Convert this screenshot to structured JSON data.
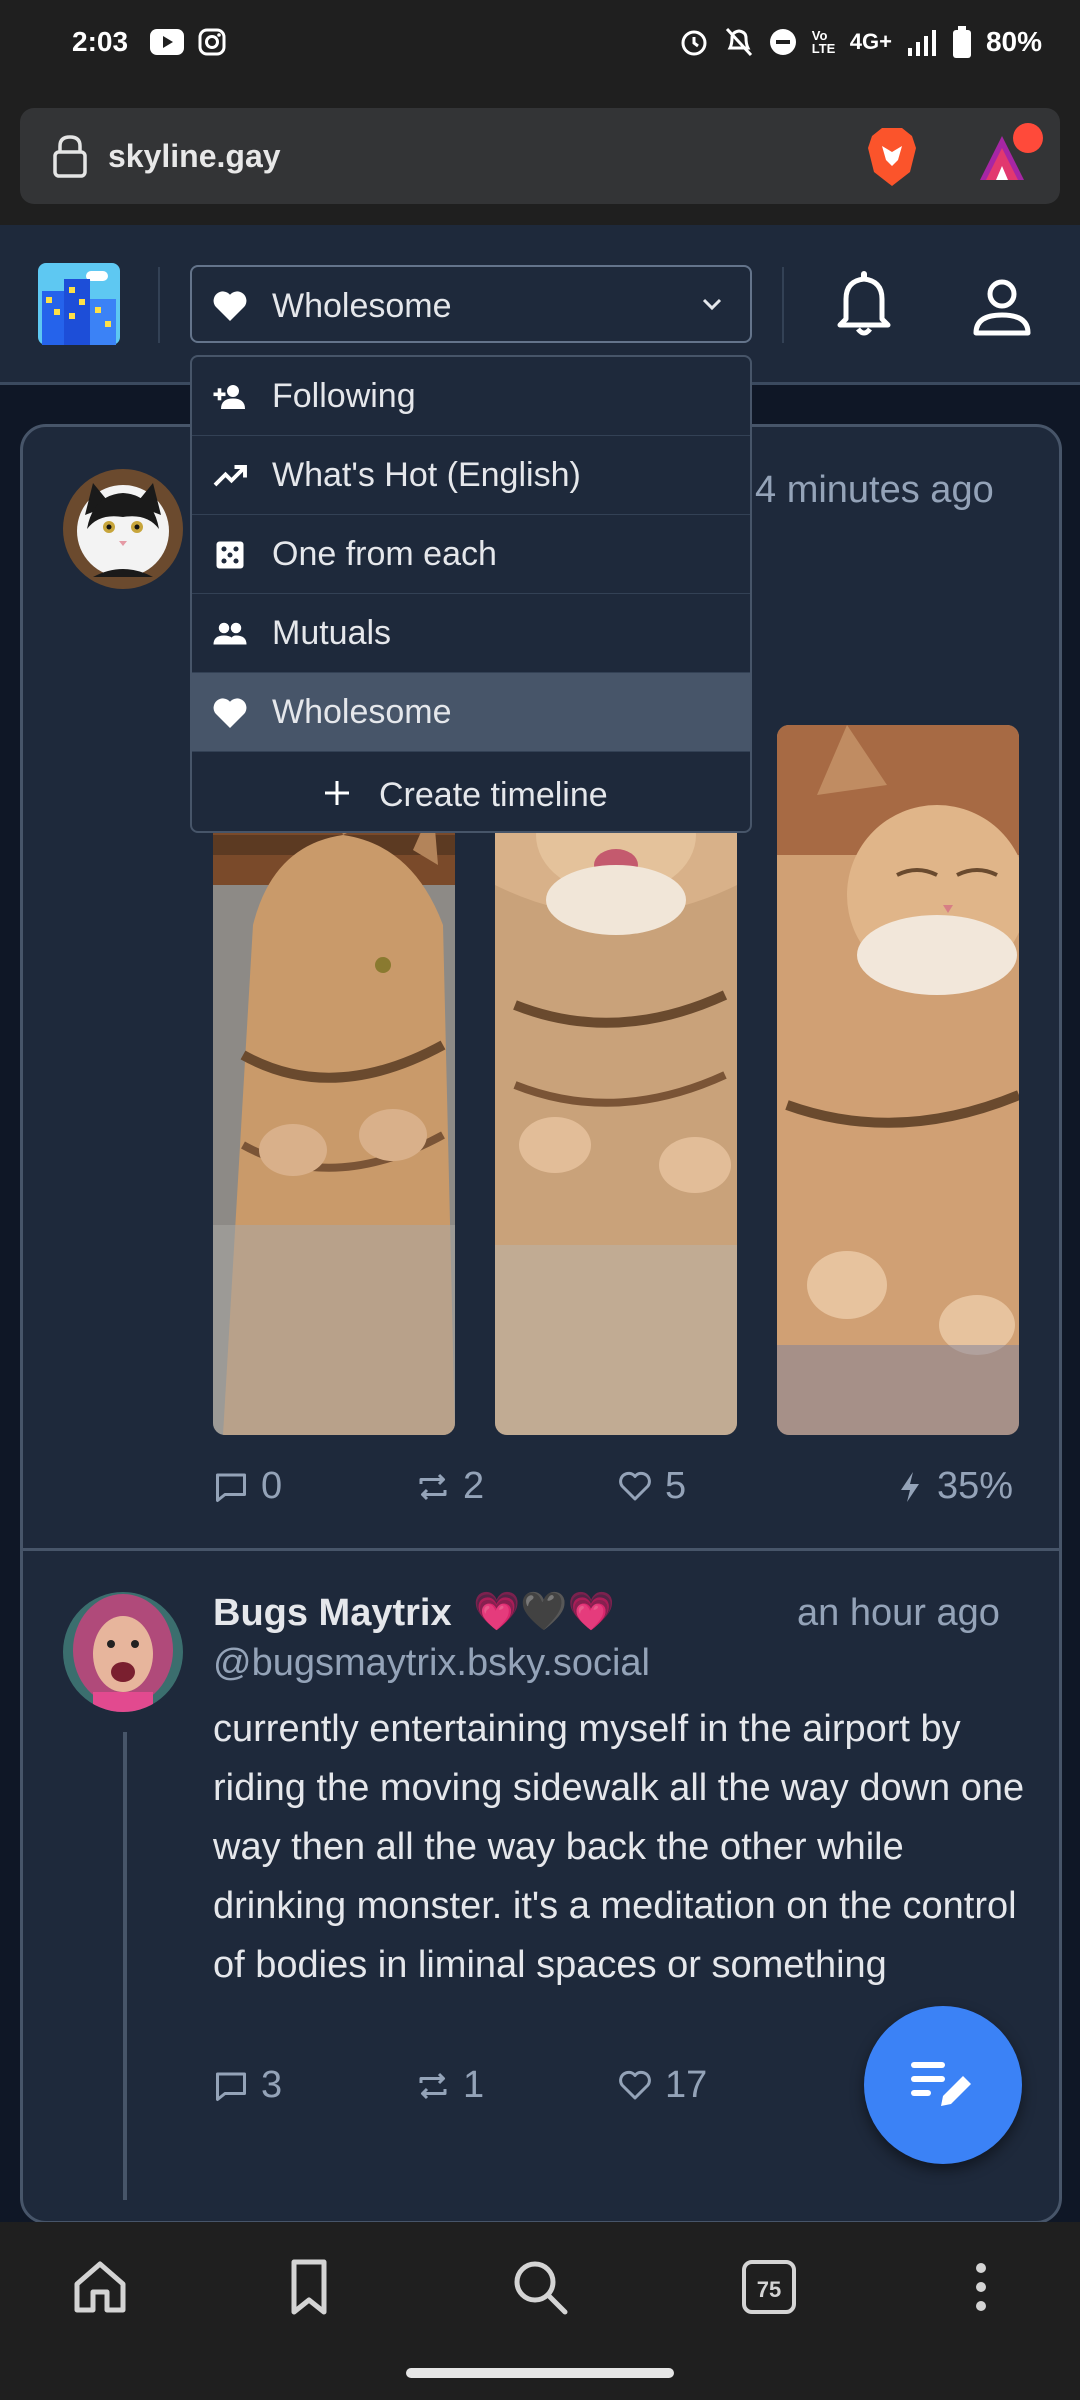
{
  "status_bar": {
    "time": "2:03",
    "network": "4G+",
    "volte": "Vo LTE",
    "battery": "80%"
  },
  "browser": {
    "url": "skyline.gay",
    "tab_count": "75"
  },
  "header": {
    "selected_feed": "Wholesome"
  },
  "dropdown": {
    "items": [
      {
        "label": "Following",
        "icon": "person-add-icon"
      },
      {
        "label": "What's Hot (English)",
        "icon": "trending-icon"
      },
      {
        "label": "One from each",
        "icon": "dice-icon"
      },
      {
        "label": "Mutuals",
        "icon": "people-icon"
      },
      {
        "label": "Wholesome",
        "icon": "heart-icon",
        "active": true
      }
    ],
    "create_label": "Create timeline"
  },
  "posts": [
    {
      "time_ago": "4 minutes ago",
      "replies": "0",
      "reposts": "2",
      "likes": "5",
      "score": "35%"
    },
    {
      "author": "Bugs Maytrix",
      "author_emoji": "💗🖤💗",
      "handle": "@bugsmaytrix.bsky.social",
      "time_ago": "an hour ago",
      "text": "currently entertaining myself in the airport by riding the moving sidewalk all the way down one way then all the way back the other while drinking monster. it's a meditation on the control of bodies in liminal spaces or something",
      "replies": "3",
      "reposts": "1",
      "likes": "17"
    }
  ],
  "colors": {
    "background": "#0f1726",
    "panel": "#1e293b",
    "border": "#475569",
    "muted_text": "#94a3b8",
    "fab": "#3b82f6",
    "active_item": "#475569"
  }
}
